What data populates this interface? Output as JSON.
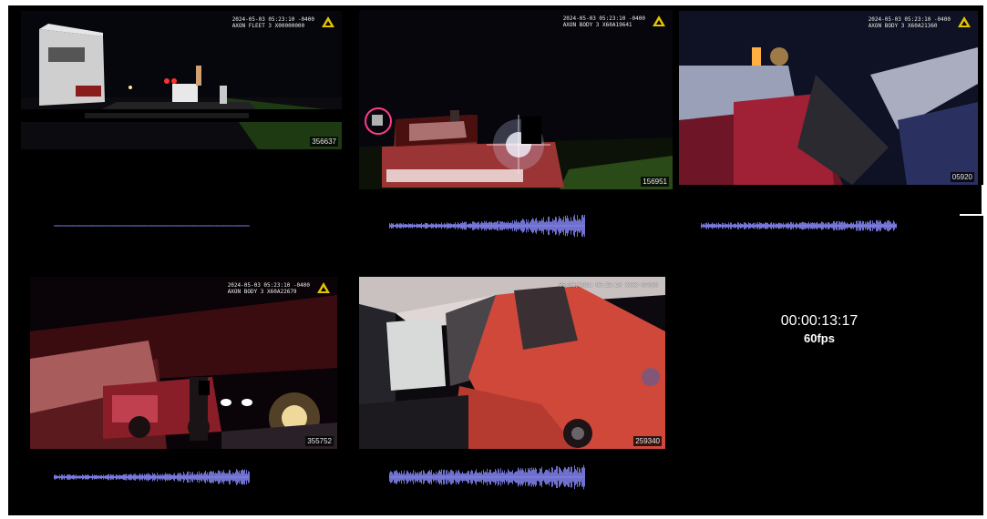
{
  "tiles": [
    {
      "id": "356637",
      "stamp_line1": "2024-05-03 05:23:10 -0400",
      "stamp_line2": "AXON FLEET 3 X00000000",
      "selected": false
    },
    {
      "id": "156951",
      "stamp_line1": "2024-05-03 05:23:10 -0400",
      "stamp_line2": "AXON BODY 3 X60A19641",
      "selected": true
    },
    {
      "id": "05920",
      "stamp_line1": "2024-05-03 05:23:10 -0400",
      "stamp_line2": "AXON BODY 3 X60A21360",
      "selected": false
    },
    {
      "id": "355752",
      "stamp_line1": "2024-05-03 05:23:10 -0400",
      "stamp_line2": "AXON BODY 3 X60A22679",
      "selected": false
    },
    {
      "id": "259340",
      "stamp_line1": "05/03/2024 05:23:10 XXX3-07038",
      "stamp_line2": "",
      "selected": false
    }
  ],
  "playback": {
    "timecode": "00:00:13:17",
    "fps": "60fps"
  },
  "icons": {
    "camera_logo": "axon-delta-icon"
  },
  "colors": {
    "selection": "#ffe600",
    "waveform": "#8a8cff",
    "background": "#000000"
  }
}
